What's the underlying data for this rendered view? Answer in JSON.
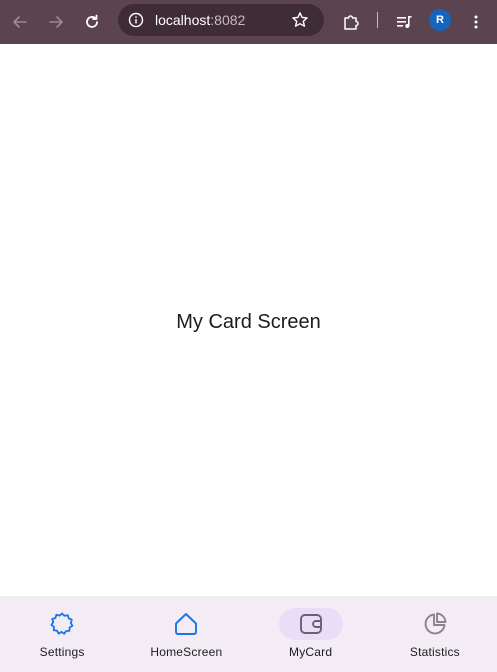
{
  "browser": {
    "url_host": "localhost",
    "url_port": ":8082",
    "profile_initial": "R"
  },
  "main": {
    "title": "My Card Screen"
  },
  "bottom_nav": {
    "items": [
      {
        "label": "Settings",
        "icon": "settings-icon"
      },
      {
        "label": "HomeScreen",
        "icon": "home-icon"
      },
      {
        "label": "MyCard",
        "icon": "wallet-icon",
        "active": true
      },
      {
        "label": "Statistics",
        "icon": "pie-chart-icon"
      }
    ]
  },
  "colors": {
    "browser_bar": "#5b4450",
    "nav_background": "#f3ecf4",
    "active_indicator": "#e8def8",
    "icon_blue": "#1a73e8",
    "icon_active": "#6b5f72"
  }
}
